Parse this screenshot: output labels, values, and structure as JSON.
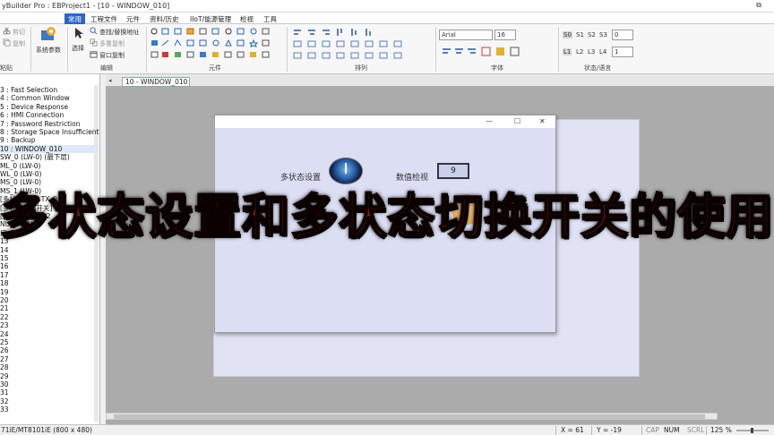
{
  "window": {
    "title": "yBuilder Pro : EBProject1 - [10 - WINDOW_010]",
    "restore_glyph": "⧉",
    "minimize_glyph": "_",
    "close_glyph": "✕"
  },
  "menu": {
    "tabs": [
      "常用",
      "工程文件",
      "元件",
      "资料/历史",
      "IIoT/能源管理",
      "检视",
      "工具"
    ]
  },
  "ribbon": {
    "clipboard": {
      "cut": "剪切",
      "copy": "复制",
      "paste": "粘贴"
    },
    "system_params": "系统参数",
    "select": "选择",
    "find_replace": "查找/替换地址",
    "multi_copy": "多重复制",
    "window_copy": "窗口复制",
    "edit_group": "编辑",
    "parts_group": "元件",
    "arrange_group": "排列",
    "font_group": "字体",
    "state_group": "状态/语言",
    "font_name": "Arial",
    "font_size": "16",
    "states": [
      "S0",
      "S1",
      "S2",
      "S3"
    ],
    "state_value": "0",
    "langs": [
      "L1",
      "L2",
      "L3",
      "L4"
    ],
    "lang_value": "1"
  },
  "tree": {
    "items": [
      "3 : Fast Selection",
      "4 : Common Window",
      "5 : Device Response",
      "6 : HMI Connection",
      "7 : Password Restriction",
      "8 : Storage Space Insufficient",
      "9 : Backup",
      "10 : WINDOW_010",
      "SW_0 (LW-0) (最下层)",
      "ML_0 (LW-0)",
      "WL_0 (LW-0)",
      "MS_0 (LW-0)",
      "MS_1 (LW-0)",
      "[多状态设置] TX_0",
      "[多状态切换开关] TX_1",
      "[数值检视] TX_2",
      "NU_0 (LW-0)",
      "口_01",
      "13",
      "14",
      "15",
      "16",
      "17",
      "18",
      "19",
      "20",
      "21",
      "22",
      "23",
      "24",
      "25",
      "26",
      "27",
      "28",
      "29",
      "30",
      "31",
      "32",
      "33"
    ],
    "selected_index": 7
  },
  "doc_tab": "10 - WINDOW_010",
  "popup": {
    "minimize": "—",
    "maximize": "☐",
    "close": "✕",
    "multi_state_label": "多状态设置",
    "numeric_label": "数值检视",
    "numeric_value": "9"
  },
  "overlay_caption": "多状态设置和多状态切换开关的使用",
  "status": {
    "model": "71iE/MT8101iE (800 x 480)",
    "x": "X = 61",
    "y": "Y = -19",
    "cap": "CAP",
    "num": "NUM",
    "scrl": "SCRL",
    "zoom": "125 %"
  },
  "colors": {
    "menu_active": "#2c64c8",
    "canvas_bg": "#ababab",
    "hmi_page": "#e1e3f5",
    "caption_fill": "#7a1810"
  }
}
